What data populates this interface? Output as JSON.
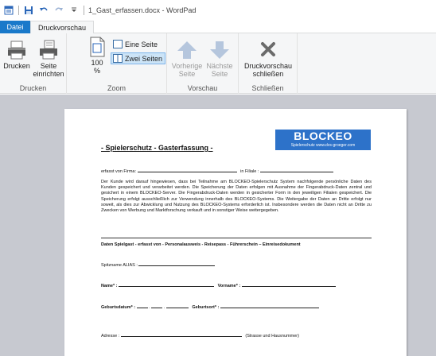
{
  "window": {
    "title": "1_Gast_erfassen.docx - WordPad"
  },
  "tabs": [
    {
      "label": "Datei"
    },
    {
      "label": "Druckvorschau"
    }
  ],
  "ribbon": {
    "print_group": {
      "label": "Drucken",
      "print_label": "Drucken",
      "setup_label_1": "Seite",
      "setup_label_2": "einrichten"
    },
    "zoom_group": {
      "label": "Zoom",
      "zoom_value": "100",
      "zoom_unit": "%",
      "one_page": "Eine Seite",
      "two_pages": "Zwei Seiten"
    },
    "preview_group": {
      "label": "Vorschau",
      "prev_1": "Vorherige",
      "prev_2": "Seite",
      "next_1": "Nächste",
      "next_2": "Seite"
    },
    "close_group": {
      "label": "Schließen",
      "close_1": "Druckvorschau",
      "close_2": "schließen"
    }
  },
  "document": {
    "logo_text": "BLOCKEO",
    "logo_sub": "Spielerschutz  www.dvs-groeger.com",
    "title": "- Spielerschutz - Gasterfassung -",
    "captured_by": "erfasst von Firma:",
    "branch": "in Filiale :",
    "paragraph": "Der Kunde wird darauf hingewiesen, dass bei Teilnahme am BLOCKEO-Spielerschutz System nachfolgende persönliche Daten des Kunden gespeichert und verarbeitet werden. Die Speicherung der Daten erfolgen mit Ausnahme der Fingerabdruck-Daten zentral und gesichert in einem BLOCKEO-Server. Die Fingerabdruck-Daten werden in gesicherter Form in den jeweiligen Filialen gespeichert. Die Speicherung erfolgt ausschließlich zur Verwendung innerhalb des BLOCKEO-Systems. Die Weitergabe der Daten an Dritte erfolgt nur soweit, als dies zur Abwicklung und Nutzung des BLOCKEO-Systems erforderlich ist. Insbesondere werden die Daten nicht an Dritte zu Zwecken von Werbung und Marktforschung verkauft und in sonstiger Weise weitergegeben.",
    "section_label": "Daten Spielgast - erfasst von - Personalausweis - Reisepass - Führerschein – Einreisedokument",
    "alias_label": "Spitzname ALIAS :",
    "name_label": "Name* :",
    "firstname_label": "Vorname* :",
    "birthdate_label": "Geburtsdatum* :",
    "birthplace_label": "Geburtsort* :",
    "address_label": "Adresse :",
    "address_hint": "(Strasse und Hausnummer)"
  }
}
